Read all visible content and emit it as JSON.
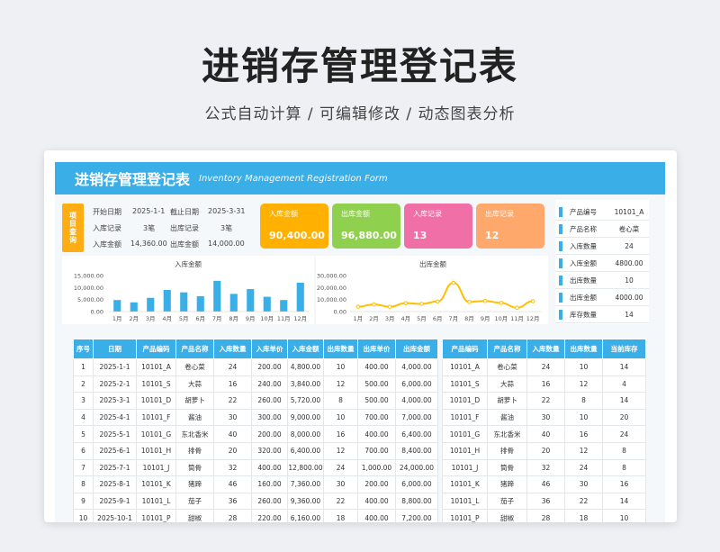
{
  "hero": {
    "title": "进销存管理登记表",
    "subtitle": "公式自动计算 /  可编辑修改  / 动态图表分析"
  },
  "banner": {
    "title": "进销存管理登记表",
    "subtitle": "Inventory Management Registration Form"
  },
  "query": {
    "tag": "项目查询",
    "start_label": "开始日期",
    "start_value": "2025-1-1",
    "end_label": "截止日期",
    "end_value": "2025-3-31",
    "in_record_label": "入库记录",
    "in_record_value": "3笔",
    "out_record_label": "出库记录",
    "out_record_value": "3笔",
    "in_amount_label": "入库金额",
    "in_amount_value": "14,360.00",
    "out_amount_label": "出库金额",
    "out_amount_value": "14,000.00"
  },
  "kpis": [
    {
      "label": "入库金额",
      "value": "90,400.00",
      "color": "#ffb000"
    },
    {
      "label": "出库金额",
      "value": "96,880.00",
      "color": "#8fd14f"
    },
    {
      "label": "入库记录",
      "value": "13",
      "color": "#f06fa6"
    },
    {
      "label": "出库记录",
      "value": "12",
      "color": "#ffa86b"
    }
  ],
  "chart_data": [
    {
      "type": "bar",
      "title": "入库金额",
      "categories": [
        "1月",
        "2月",
        "3月",
        "4月",
        "5月",
        "6月",
        "7月",
        "8月",
        "9月",
        "10月",
        "11月",
        "12月"
      ],
      "values": [
        4800,
        3840,
        5720,
        9000,
        8000,
        6400,
        12800,
        7360,
        9360,
        6160,
        4800,
        12000
      ],
      "yticks": [
        "15,000.00",
        "10,000.00",
        "5,000.00",
        "0.00"
      ],
      "ylim": [
        0,
        15000
      ],
      "color": "#3aaee6"
    },
    {
      "type": "line",
      "title": "出库金额",
      "categories": [
        "1月",
        "2月",
        "3月",
        "4月",
        "5月",
        "6月",
        "7月",
        "8月",
        "9月",
        "10月",
        "11月",
        "12月"
      ],
      "values": [
        4000,
        6000,
        4000,
        7000,
        6400,
        8400,
        24000,
        8000,
        8800,
        7200,
        3200,
        8600
      ],
      "yticks": [
        "30,000.00",
        "20,000.00",
        "10,000.00",
        "0.00"
      ],
      "ylim": [
        0,
        30000
      ],
      "color": "#ffc000"
    }
  ],
  "side": [
    {
      "label": "产品编号",
      "value": "10101_A"
    },
    {
      "label": "产品名称",
      "value": "卷心菜"
    },
    {
      "label": "入库数量",
      "value": "24"
    },
    {
      "label": "入库金额",
      "value": "4800.00"
    },
    {
      "label": "出库数量",
      "value": "10"
    },
    {
      "label": "出库金额",
      "value": "4000.00"
    },
    {
      "label": "库存数量",
      "value": "14"
    }
  ],
  "main_table": {
    "headers": [
      "序号",
      "日期",
      "产品编码",
      "产品名称",
      "入库数量",
      "入库单价",
      "入库金额",
      "出库数量",
      "出库单价",
      "出库金额"
    ],
    "rows": [
      [
        "1",
        "2025-1-1",
        "10101_A",
        "卷心菜",
        "24",
        "200.00",
        "4,800.00",
        "10",
        "400.00",
        "4,000.00"
      ],
      [
        "2",
        "2025-2-1",
        "10101_S",
        "大蒜",
        "16",
        "240.00",
        "3,840.00",
        "12",
        "500.00",
        "6,000.00"
      ],
      [
        "3",
        "2025-3-1",
        "10101_D",
        "胡萝卜",
        "22",
        "260.00",
        "5,720.00",
        "8",
        "500.00",
        "4,000.00"
      ],
      [
        "4",
        "2025-4-1",
        "10101_F",
        "酱油",
        "30",
        "300.00",
        "9,000.00",
        "10",
        "700.00",
        "7,000.00"
      ],
      [
        "5",
        "2025-5-1",
        "10101_G",
        "东北香米",
        "40",
        "200.00",
        "8,000.00",
        "16",
        "400.00",
        "6,400.00"
      ],
      [
        "6",
        "2025-6-1",
        "10101_H",
        "排骨",
        "20",
        "320.00",
        "6,400.00",
        "12",
        "700.00",
        "8,400.00"
      ],
      [
        "7",
        "2025-7-1",
        "10101_J",
        "筒骨",
        "32",
        "400.00",
        "12,800.00",
        "24",
        "1,000.00",
        "24,000.00"
      ],
      [
        "8",
        "2025-8-1",
        "10101_K",
        "猪蹄",
        "46",
        "160.00",
        "7,360.00",
        "30",
        "200.00",
        "6,000.00"
      ],
      [
        "9",
        "2025-9-1",
        "10101_L",
        "茄子",
        "36",
        "260.00",
        "9,360.00",
        "22",
        "400.00",
        "8,800.00"
      ],
      [
        "10",
        "2025-10-1",
        "10101_P",
        "甜椒",
        "28",
        "220.00",
        "6,160.00",
        "18",
        "400.00",
        "7,200.00"
      ]
    ]
  },
  "stock_table": {
    "headers": [
      "产品编码",
      "产品名称",
      "入库数量",
      "出库数量",
      "当前库存"
    ],
    "rows": [
      [
        "10101_A",
        "卷心菜",
        "24",
        "10",
        "14"
      ],
      [
        "10101_S",
        "大蒜",
        "16",
        "12",
        "4"
      ],
      [
        "10101_D",
        "胡萝卜",
        "22",
        "8",
        "14"
      ],
      [
        "10101_F",
        "酱油",
        "30",
        "10",
        "20"
      ],
      [
        "10101_G",
        "东北香米",
        "40",
        "16",
        "24"
      ],
      [
        "10101_H",
        "排骨",
        "20",
        "12",
        "8"
      ],
      [
        "10101_J",
        "筒骨",
        "32",
        "24",
        "8"
      ],
      [
        "10101_K",
        "猪蹄",
        "46",
        "30",
        "16"
      ],
      [
        "10101_L",
        "茄子",
        "36",
        "22",
        "14"
      ],
      [
        "10101_P",
        "甜椒",
        "28",
        "18",
        "10"
      ]
    ]
  }
}
